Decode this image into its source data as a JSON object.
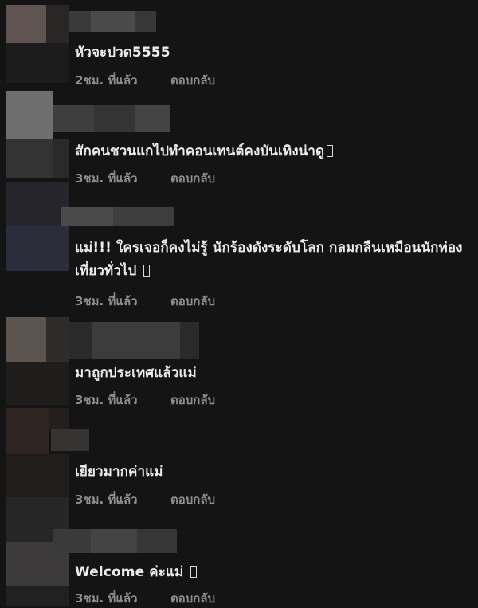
{
  "comments": [
    {
      "text": "หัวจะปวด5555",
      "time": "2ชม. ที่แล้ว",
      "reply": "ตอบกลับ",
      "has_glyph": false
    },
    {
      "text": "สักคนชวนแกไปทำคอนเทนต์คงบันเทิงน่าดู",
      "time": "3ชม. ที่แล้ว",
      "reply": "ตอบกลับ",
      "has_glyph": true
    },
    {
      "text": "แม่!!! ใครเจอก็คงไม่รู้ นักร้องดังระดับโลก กลมกลืนเหมือนนักท่องเที่ยวทั่วไป",
      "time": "3ชม. ที่แล้ว",
      "reply": "ตอบกลับ",
      "has_glyph": true
    },
    {
      "text": "มาถูกประเทศแล้วแม่",
      "time": "3ชม. ที่แล้ว",
      "reply": "ตอบกลับ",
      "has_glyph": false
    },
    {
      "text": "เยียวมากค่าแม่",
      "time": "3ชม. ที่แล้ว",
      "reply": "ตอบกลับ",
      "has_glyph": false
    },
    {
      "text": "Welcome ค่ะแม่",
      "time": "3ชม. ที่แล้ว",
      "reply": "ตอบกลับ",
      "has_glyph": true
    }
  ]
}
